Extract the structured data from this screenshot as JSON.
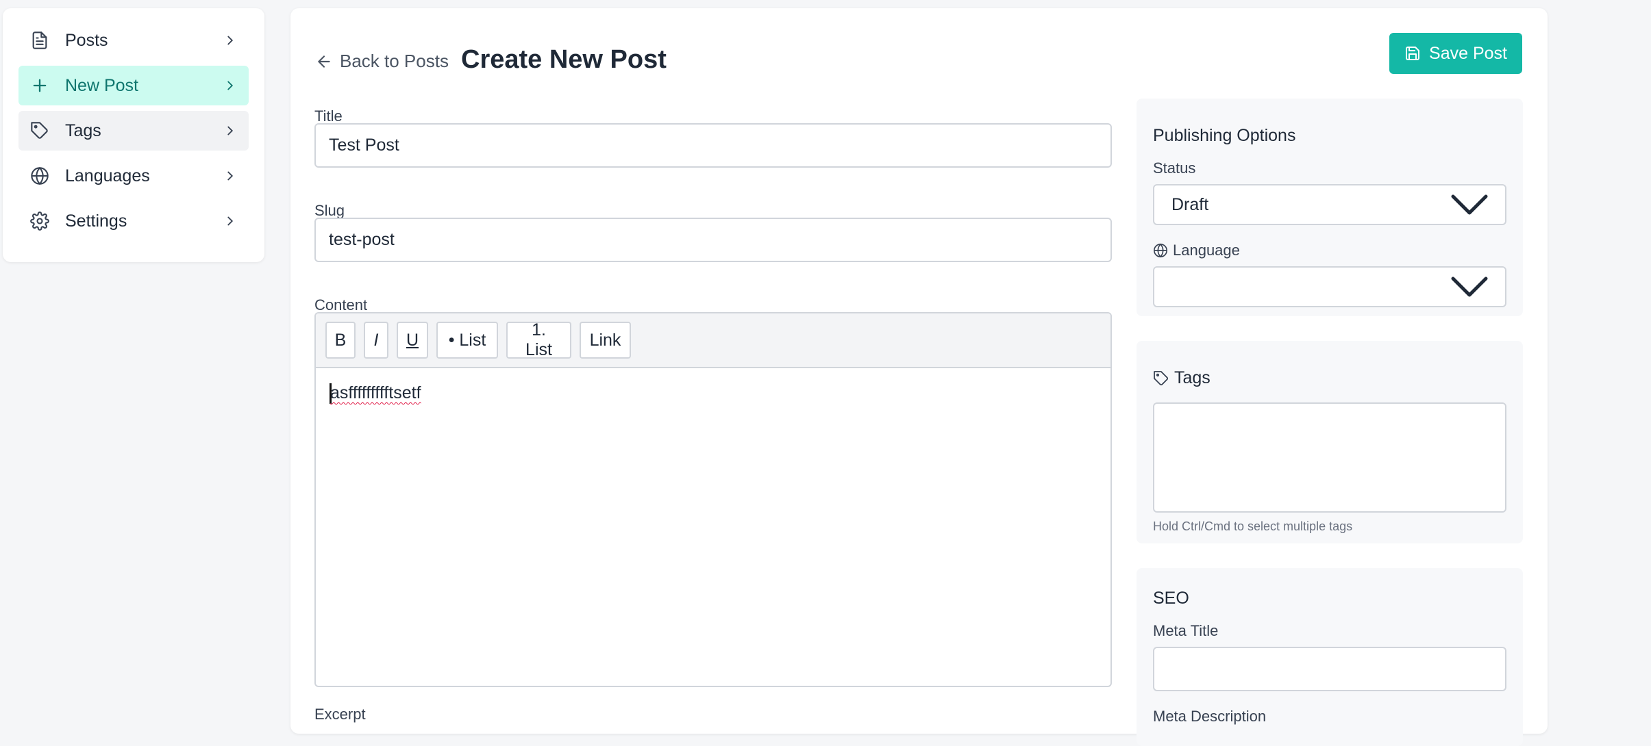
{
  "sidebar": {
    "items": [
      {
        "label": "Posts",
        "icon": "document-icon"
      },
      {
        "label": "New Post",
        "icon": "plus-icon"
      },
      {
        "label": "Tags",
        "icon": "tag-icon"
      },
      {
        "label": "Languages",
        "icon": "globe-icon"
      },
      {
        "label": "Settings",
        "icon": "gear-icon"
      }
    ]
  },
  "header": {
    "back_label": "Back to Posts",
    "title": "Create New Post",
    "save_label": "Save Post"
  },
  "form": {
    "title_label": "Title",
    "title_value": "Test Post",
    "slug_label": "Slug",
    "slug_value": "test-post",
    "content_label": "Content",
    "toolbar": {
      "bold": "B",
      "italic": "I",
      "underline": "U",
      "bullet_list": "• List",
      "numbered_list": "1. List",
      "link": "Link"
    },
    "content_value": "asffffffffftsetf",
    "excerpt_label": "Excerpt"
  },
  "publishing": {
    "title": "Publishing Options",
    "status_label": "Status",
    "status_value": "Draft",
    "language_label": "Language",
    "language_value": ""
  },
  "tags_panel": {
    "title": "Tags",
    "hint": "Hold Ctrl/Cmd to select multiple tags"
  },
  "seo": {
    "title": "SEO",
    "meta_title_label": "Meta Title",
    "meta_description_label": "Meta Description"
  },
  "colors": {
    "accent": "#14b8a6",
    "active_bg": "#ccfbf0",
    "active_text": "#0f766e"
  }
}
